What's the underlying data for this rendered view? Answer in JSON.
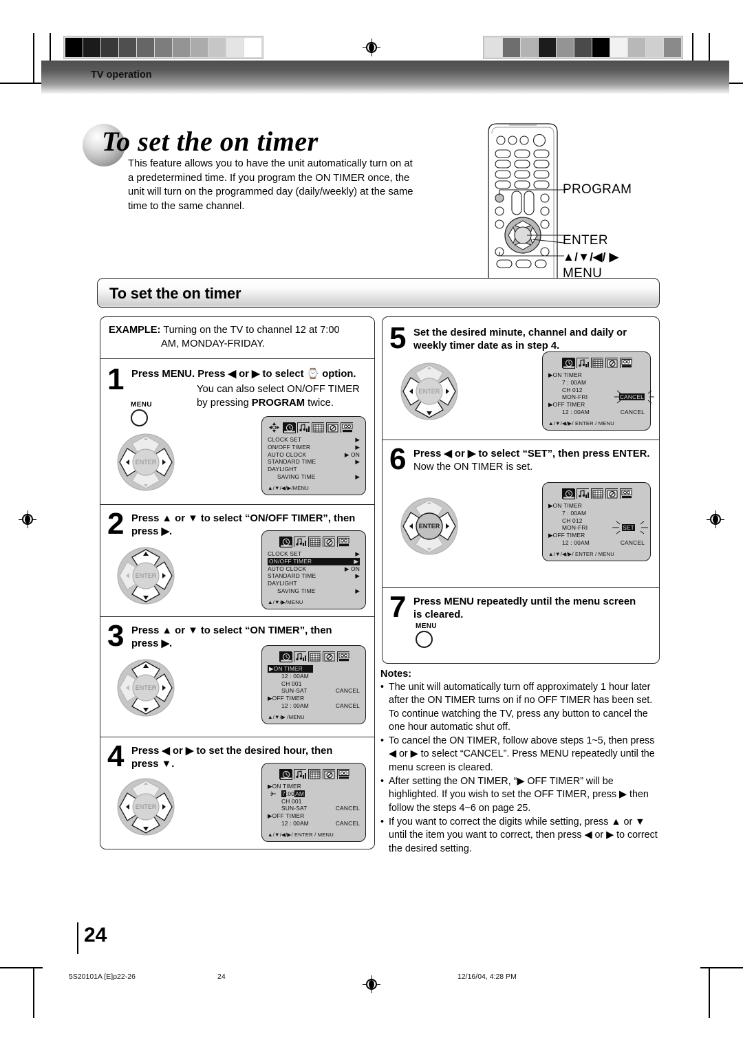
{
  "header": {
    "section_label": "TV operation"
  },
  "title": {
    "heading": "To set the on timer",
    "intro": "This feature allows you to have the unit automatically turn on at a predetermined time. If you program the ON TIMER once, the unit will turn on the programmed day (daily/weekly) at the same time to the same channel."
  },
  "remote_callouts": {
    "program": "PROGRAM",
    "enter": "ENTER",
    "arrows": "▲/▼/◀/ ▶",
    "menu": "MENU"
  },
  "section_bar": {
    "label": "To set the on timer"
  },
  "example": {
    "prefix": "EXAMPLE:",
    "line1": "Turning on the TV to channel 12 at 7:00",
    "line2": "AM, MONDAY-FRIDAY."
  },
  "steps": [
    {
      "num": "1",
      "head": "Press MENU. Press ◀ or ▶ to select ⌚ option.",
      "sub_line1": "You can also select ON/OFF TIMER",
      "sub_line2_pre": "by pressing ",
      "sub_line2_bold": "PROGRAM",
      "sub_line2_post": " twice.",
      "button_label": "MENU"
    },
    {
      "num": "2",
      "head_line1": "Press ▲ or ▼ to select “ON/OFF TIMER”, then",
      "head_line2": "press ▶."
    },
    {
      "num": "3",
      "head_line1": "Press ▲ or ▼ to select “ON TIMER”, then",
      "head_line2": "press ▶."
    },
    {
      "num": "4",
      "head_line1": "Press ◀ or ▶ to set the desired hour, then",
      "head_line2": "press ▼."
    },
    {
      "num": "5",
      "head_line1": "Set the desired minute, channel and daily or",
      "head_line2": "weekly timer date as in step 4."
    },
    {
      "num": "6",
      "head_line1": "Press ◀ or ▶ to select “SET”, then press ENTER.",
      "sub_line1": "Now the ON TIMER is set."
    },
    {
      "num": "7",
      "head_line1": "Press MENU repeatedly until the menu screen",
      "head_line2": "is cleared.",
      "button_label": "MENU"
    }
  ],
  "osd": {
    "nav_footer_short": "▲/▼/▶/MENU",
    "nav_footer_clock": "▲/▼/◀/▶/MENU",
    "nav_footer_full": "▲/▼/◀/▶/ ENTER / MENU",
    "icons": [
      "clock-icon",
      "audio-icon",
      "grid-icon",
      "no-signal-icon",
      "caption-icon"
    ],
    "clock_menu": {
      "rows": [
        {
          "label": "CLOCK  SET",
          "value": "▶",
          "highlight": false
        },
        {
          "label": "ON/OFF  TIMER",
          "value": "▶",
          "highlight": false
        },
        {
          "label": "AUTO  CLOCK",
          "value": "▶ ON",
          "highlight": false
        },
        {
          "label": "STANDARD  TIME",
          "value": "▶",
          "highlight": false
        },
        {
          "label": "DAYLIGHT",
          "value": "",
          "highlight": false
        },
        {
          "label": "SAVING  TIME",
          "value": "▶",
          "highlight": false,
          "indent": true
        }
      ]
    },
    "clock_menu_step2": {
      "rows": [
        {
          "label": "CLOCK  SET",
          "value": "▶",
          "highlight": false
        },
        {
          "label": "ON/OFF  TIMER",
          "value": "▶",
          "highlight": true
        },
        {
          "label": "AUTO  CLOCK",
          "value": "▶ ON",
          "highlight": false
        },
        {
          "label": "STANDARD  TIME",
          "value": "▶",
          "highlight": false
        },
        {
          "label": "DAYLIGHT",
          "value": "",
          "highlight": false
        },
        {
          "label": "SAVING  TIME",
          "value": "▶",
          "highlight": false,
          "indent": true
        }
      ]
    },
    "timer_step3": {
      "on_timer_label": "▶ON  TIMER",
      "on_timer_highlight": true,
      "time": "12 : 00AM",
      "channel": "CH 001",
      "days": "SUN-SAT",
      "days_action": "CANCEL",
      "off_timer_label": "▶OFF TIMER",
      "off_time": "12 : 00AM",
      "off_action": "CANCEL",
      "footer": "▲/▼/▶ /MENU"
    },
    "timer_step4": {
      "on_timer_label": "▶ON TIMER",
      "hour": "7",
      "minute": "00",
      "meridiem": "AM",
      "channel": "CH 001",
      "days": "SUN-SAT",
      "days_action": "CANCEL",
      "off_timer_label": "▶OFF TIMER",
      "off_time": "12 : 00AM",
      "off_action": "CANCEL",
      "footer": "▲/▼/◀/▶/ ENTER / MENU"
    },
    "timer_step5": {
      "on_timer_label": "▶ON TIMER",
      "time": "7 : 00AM",
      "channel": "CH 012",
      "days": "MON-FRI",
      "days_action": "CANCEL",
      "off_timer_label": "▶OFF TIMER",
      "off_time": "12 : 00AM",
      "off_action": "CANCEL",
      "footer": "▲/▼/◀/▶/ ENTER / MENU"
    },
    "timer_step6": {
      "on_timer_label": "▶ON TIMER",
      "time": "7 : 00AM",
      "channel": "CH 012",
      "days": "MON-FRI",
      "days_action": "SET",
      "off_timer_label": "▶OFF TIMER",
      "off_time": "12 : 00AM",
      "off_action": "CANCEL",
      "footer": "▲/▼/◀/▶/ ENTER / MENU"
    }
  },
  "notes": {
    "title": "Notes:",
    "items": [
      "The unit will automatically turn off approximately 1 hour later after the ON TIMER turns on if no OFF TIMER has been set. To continue watching the TV, press any button to cancel the one hour automatic shut off.",
      "To cancel the ON TIMER, follow above steps 1~5, then press ◀ or ▶ to select “CANCEL”. Press MENU repeatedly until the menu screen is cleared.",
      "After setting the ON TIMER, “▶ OFF TIMER” will be highlighted. If you wish to set the OFF TIMER, press ▶ then follow the steps 4~6 on page 25.",
      "If you want to correct the digits while setting, press ▲ or ▼ until the item you want to correct, then press ◀ or ▶ to correct the desired setting."
    ]
  },
  "footer": {
    "page_number": "24",
    "doc_id": "5S20101A [E]p22-26",
    "center_page": "24",
    "timestamp": "12/16/04, 4:28 PM"
  },
  "colors": {
    "header_dark": "#4e4e4e",
    "osd_bg": "#c9c9c9",
    "osd_highlight": "#111111",
    "ink": "#000000"
  },
  "grayscale_bar_left": [
    "#000000",
    "#1b1b1b",
    "#383838",
    "#4f4f4f",
    "#666666",
    "#7d7d7d",
    "#949494",
    "#ababab",
    "#c6c6c6",
    "#e4e4e4",
    "#ffffff"
  ],
  "grayscale_bar_right": [
    "#e0e0e0",
    "#6e6e6e",
    "#b3b3b3",
    "#1c1c1c",
    "#949494",
    "#4a4a4a",
    "#000000",
    "#f2f2f2",
    "#b8b8b8",
    "#cfcfcf",
    "#8a8a8a"
  ]
}
